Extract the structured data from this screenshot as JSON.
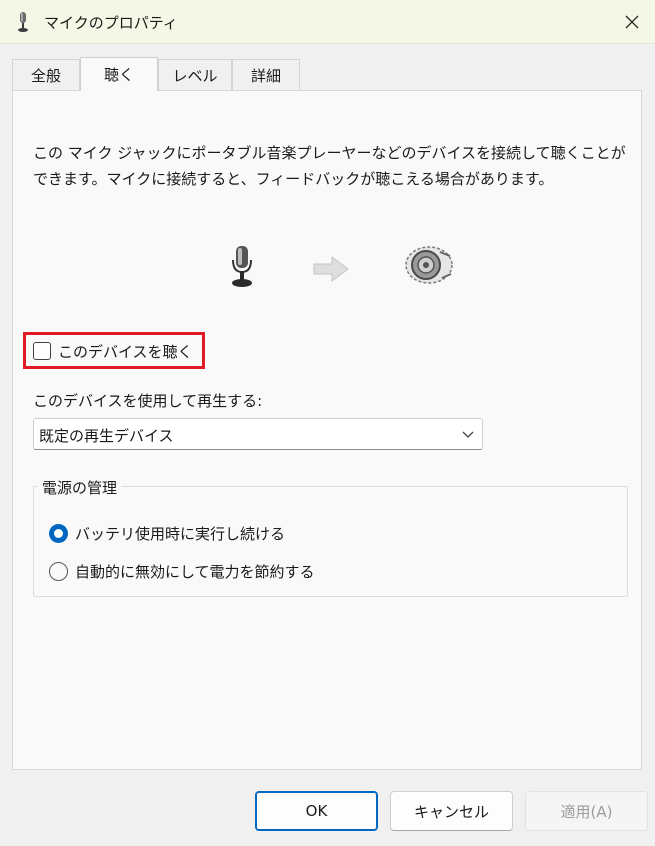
{
  "window": {
    "title": "マイクのプロパティ",
    "icon": "microphone-icon",
    "close_icon": "close-icon"
  },
  "tabs": [
    {
      "label": "全般",
      "active": false
    },
    {
      "label": "聴く",
      "active": true
    },
    {
      "label": "レベル",
      "active": false
    },
    {
      "label": "詳細",
      "active": false
    }
  ],
  "listen": {
    "description": "この マイク ジャックにポータブル音楽プレーヤーなどのデバイスを接続して聴くことができます。マイクに接続すると、フィードバックが聴こえる場合があります。",
    "illustration": [
      "microphone-icon",
      "arrow-right-icon",
      "speaker-icon"
    ],
    "listen_checkbox": {
      "label": "このデバイスを聴く",
      "checked": false
    },
    "playback_label": "このデバイスを使用して再生する:",
    "playback_select": {
      "value": "既定の再生デバイス"
    },
    "power": {
      "title": "電源の管理",
      "options": [
        {
          "label": "バッテリ使用時に実行し続ける",
          "selected": true
        },
        {
          "label": "自動的に無効にして電力を節約する",
          "selected": false
        }
      ]
    }
  },
  "buttons": {
    "ok": "OK",
    "cancel": "キャンセル",
    "apply": "適用(A)"
  },
  "colors": {
    "accent": "#0067c0",
    "highlight_border": "#e01b24",
    "titlebar": "#f5f7e6"
  }
}
